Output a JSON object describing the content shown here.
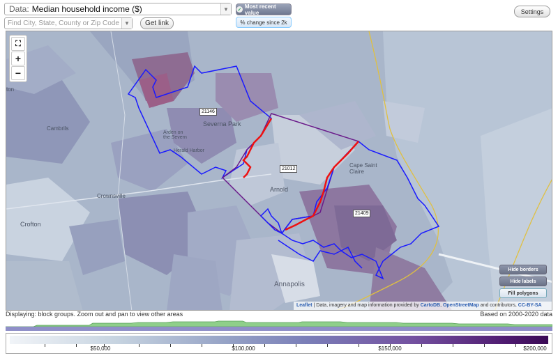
{
  "header": {
    "data_prefix": "Data:",
    "data_value": "Median household income ($)",
    "find_placeholder": "Find City, State, County or Zip Code",
    "get_link": "Get link",
    "most_recent": "Most recent value",
    "pct_change": "% change since 2k",
    "settings": "Settings"
  },
  "map": {
    "zoom_in": "+",
    "zoom_out": "−",
    "zip_labels": [
      "21146",
      "21012",
      "21409"
    ],
    "towns": [
      "Severna Park",
      "Arden on the Severn",
      "Herald Harbor",
      "Cape Saint Claire",
      "Arnold",
      "Crownsville",
      "Crofton",
      "Cambrils",
      "Annapolis",
      "ton"
    ],
    "hide_borders": "Hide borders",
    "hide_labels": "Hide labels",
    "fill_polygons": "Fill polygons",
    "attribution_leaflet": "Leaflet",
    "attribution_text": "| Data, imagery and map information provided by",
    "attribution_carto": "CartoDB",
    "attribution_osm": "OpenStreetMap",
    "attribution_tail": "and contributors,",
    "attribution_cc": "CC-BY-SA"
  },
  "footer": {
    "displaying": "Displaying: block groups. Zoom out and pan to view other areas",
    "based_on": "Based on 2000-2020 data",
    "legend_labels": [
      "$50,000",
      "$100,000",
      "$150,000",
      "$200,000"
    ]
  },
  "colors": {
    "boundary_blue": "#1a1aff",
    "boundary_red": "#ee1111",
    "boundary_purple": "#6a1a8a",
    "road_yellow": "#e0c040"
  }
}
